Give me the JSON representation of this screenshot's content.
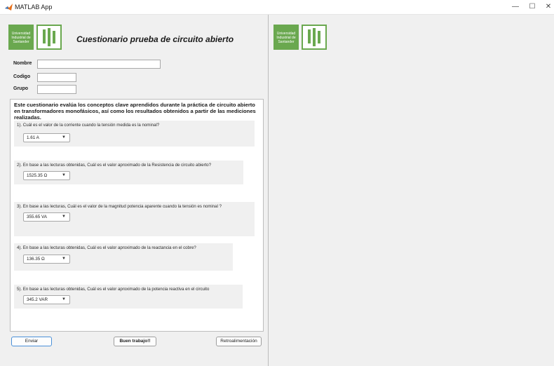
{
  "window": {
    "title": "MATLAB App",
    "minimize_glyph": "—",
    "maximize_glyph": "☐",
    "close_glyph": "✕"
  },
  "header": {
    "logo_text": "Universidad Industrial de Santander",
    "title": "Cuestionario prueba de circuito abierto"
  },
  "form": {
    "nombre_label": "Nombre",
    "nombre_value": "",
    "codigo_label": "Codigo",
    "codigo_value": "",
    "grupo_label": "Grupo",
    "grupo_value": ""
  },
  "quiz": {
    "intro": "Este cuestionario evalúa los conceptos clave aprendidos durante la práctica de circuito abierto en transformadores monofásicos, así como los resultados obtenidos a partir de las mediciones realizadas.",
    "questions": [
      {
        "text": "1). Cuál es el valor de la corriente cuando la tensión medida es la nominal?",
        "answer": "1.61 A"
      },
      {
        "text": "2). En base a las lecturas obtenidas, Cuál es el valor aproximado de la Resistencia de circuito abierto?",
        "answer": "1525.35 Ω"
      },
      {
        "text": "3). En base a las lecturas, Cuál es el valor de la magnitud potencia aparente cuando la tensión es nominal ?",
        "answer": "355.65 VA"
      },
      {
        "text": "4). En base a las lecturas obtenidas, Cuál es el valor aproximado de la reactancia en el cobre?",
        "answer": "136.35 Ω"
      },
      {
        "text": "5). En base a las lecturas obtenidas, Cuál es el valor aproximado de la potencia reactiva en el circuito",
        "answer": "345.2 VAR"
      }
    ]
  },
  "footer": {
    "enviar_label": "Enviar",
    "status_label": "Buen trabajo!!",
    "retro_label": "Retroalimentación"
  },
  "colors": {
    "brand_green": "#6aa84f",
    "accent_blue": "#4a90d9"
  },
  "icons": {
    "app": "matlab-icon",
    "logo": "uis-logo-mark"
  }
}
